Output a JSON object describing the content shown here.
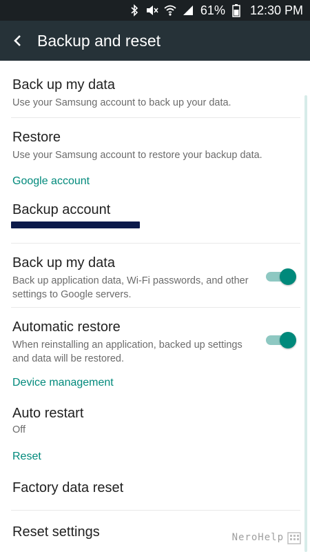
{
  "status_bar": {
    "battery": "61%",
    "time": "12:30 PM"
  },
  "app_bar": {
    "title": "Backup and reset"
  },
  "sections": {
    "google_account": "Google account",
    "device_management": "Device management",
    "reset": "Reset"
  },
  "items": {
    "samsung_backup": {
      "title": "Back up my data",
      "subtitle": "Use your Samsung account to back up your data."
    },
    "samsung_restore": {
      "title": "Restore",
      "subtitle": "Use your Samsung account to restore your backup data."
    },
    "backup_account": {
      "title": "Backup account"
    },
    "google_backup": {
      "title": "Back up my data",
      "subtitle_line1": "Back up application data, Wi-Fi passwords, and other",
      "subtitle_line2": "settings to Google servers.",
      "enabled": true
    },
    "automatic_restore": {
      "title": "Automatic restore",
      "subtitle_line1": "When reinstalling an application, backed up settings",
      "subtitle_line2": "and data will be restored.",
      "enabled": true
    },
    "auto_restart": {
      "title": "Auto restart",
      "value": "Off"
    },
    "factory_reset": {
      "title": "Factory data reset"
    },
    "reset_settings": {
      "title": "Reset settings"
    }
  },
  "watermark": {
    "text": "NeroHelp"
  },
  "colors": {
    "accent": "#00897b",
    "app_bar": "#263238",
    "status_bar": "#1b2023"
  }
}
